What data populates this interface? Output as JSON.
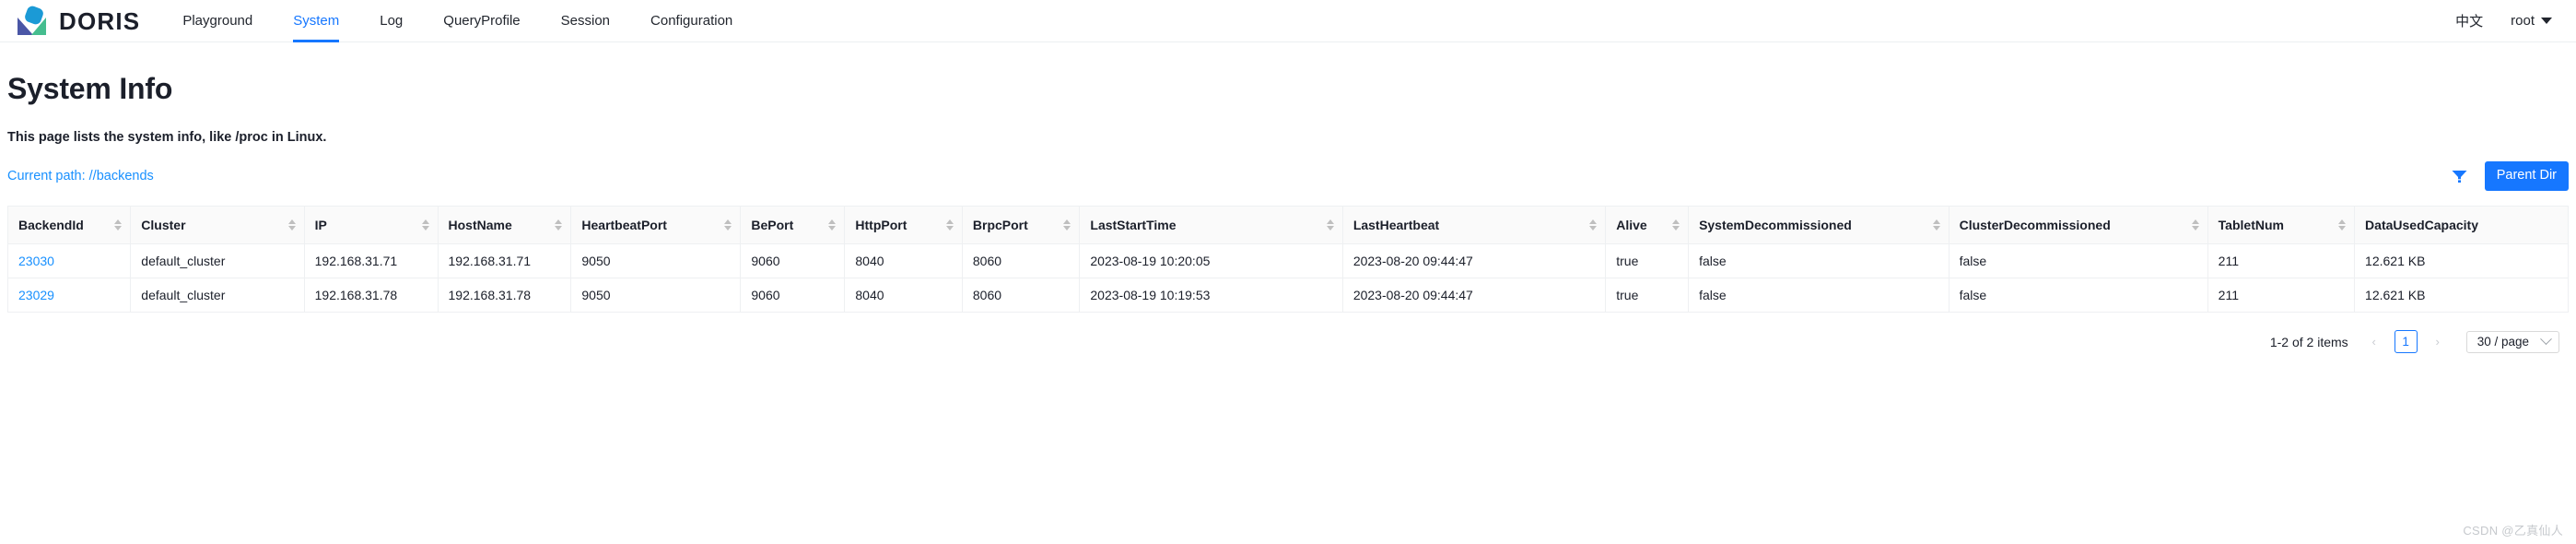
{
  "header": {
    "brand": "DORIS",
    "logo_colors": {
      "blue": "#1b9ad6",
      "indigo": "#4a56a6",
      "green": "#45bd8f"
    },
    "nav": [
      {
        "label": "Playground",
        "active": false
      },
      {
        "label": "System",
        "active": true
      },
      {
        "label": "Log",
        "active": false
      },
      {
        "label": "QueryProfile",
        "active": false
      },
      {
        "label": "Session",
        "active": false
      },
      {
        "label": "Configuration",
        "active": false
      }
    ],
    "language": "中文",
    "user": "root",
    "accent": "#1677ff"
  },
  "page": {
    "title": "System Info",
    "description": "This page lists the system info, like /proc in Linux.",
    "current_path": "Current path: //backends",
    "filter_icon": "filter-icon",
    "parent_dir_label": "Parent Dir"
  },
  "table": {
    "columns": [
      "BackendId",
      "Cluster",
      "IP",
      "HostName",
      "HeartbeatPort",
      "BePort",
      "HttpPort",
      "BrpcPort",
      "LastStartTime",
      "LastHeartbeat",
      "Alive",
      "SystemDecommissioned",
      "ClusterDecommissioned",
      "TabletNum",
      "DataUsedCapacity"
    ],
    "rows": [
      {
        "BackendId": "23030",
        "Cluster": "default_cluster",
        "IP": "192.168.31.71",
        "HostName": "192.168.31.71",
        "HeartbeatPort": "9050",
        "BePort": "9060",
        "HttpPort": "8040",
        "BrpcPort": "8060",
        "LastStartTime": "2023-08-19 10:20:05",
        "LastHeartbeat": "2023-08-20 09:44:47",
        "Alive": "true",
        "SystemDecommissioned": "false",
        "ClusterDecommissioned": "false",
        "TabletNum": "211",
        "DataUsedCapacity": "12.621 KB"
      },
      {
        "BackendId": "23029",
        "Cluster": "default_cluster",
        "IP": "192.168.31.78",
        "HostName": "192.168.31.78",
        "HeartbeatPort": "9050",
        "BePort": "9060",
        "HttpPort": "8040",
        "BrpcPort": "8060",
        "LastStartTime": "2023-08-19 10:19:53",
        "LastHeartbeat": "2023-08-20 09:44:47",
        "Alive": "true",
        "SystemDecommissioned": "false",
        "ClusterDecommissioned": "false",
        "TabletNum": "211",
        "DataUsedCapacity": "12.621 KB"
      }
    ]
  },
  "pagination": {
    "total_text": "1-2 of 2 items",
    "prev_icon": "chevron-left-icon",
    "next_icon": "chevron-right-icon",
    "current_page": "1",
    "page_size": "30 / page"
  },
  "watermark": "CSDN @乙真仙人"
}
